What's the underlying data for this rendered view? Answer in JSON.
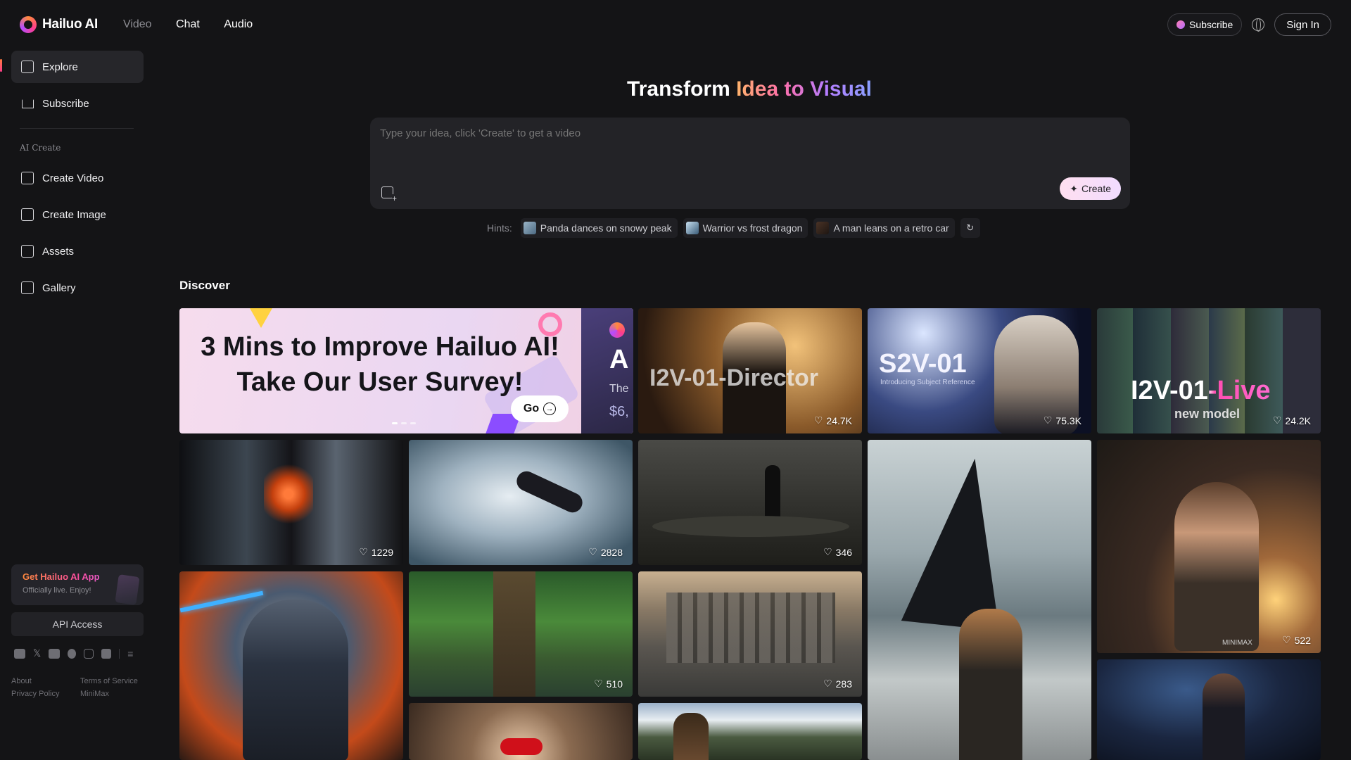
{
  "topbar": {
    "logo_text": "Hailuo AI",
    "nav": [
      "Video",
      "Chat",
      "Audio"
    ],
    "subscribe_label": "Subscribe",
    "signin_label": "Sign In"
  },
  "sidebar": {
    "explore": "Explore",
    "subscribe": "Subscribe",
    "section_heading": "AI Create",
    "create_video": "Create Video",
    "create_image": "Create Image",
    "assets": "Assets",
    "gallery": "Gallery",
    "app_card_title": "Get Hailuo AI App",
    "app_card_subtitle": "Officially live. Enjoy!",
    "api_access": "API Access",
    "footer": [
      "About",
      "Terms of Service",
      "Privacy Policy",
      "MiniMax"
    ]
  },
  "hero": {
    "title_plain": "Transform ",
    "title_grad": "Idea to Visual",
    "placeholder": "Type your idea, click 'Create' to get a video",
    "create_label": "Create",
    "hints_label": "Hints:",
    "hints": [
      "Panda dances on snowy peak",
      "Warrior vs frost dragon",
      "A man leans on a retro car"
    ]
  },
  "discover": {
    "heading": "Discover",
    "banner": {
      "line1": "3 Mins to Improve Hailuo AI!",
      "line2": "Take Our User Survey!",
      "go_label": "Go",
      "side_big": "A",
      "side_small1": "The",
      "side_small2": "$6,"
    },
    "cards": [
      {
        "overlay": "I2V-01-Director",
        "likes": "24.7K"
      },
      {
        "overlay": "S2V-01",
        "overlay_sub": "Introducing Subject Reference",
        "likes": "75.3K"
      },
      {
        "overlay": "I2V-01-Live",
        "overlay_sub": "new model",
        "likes": "24.2K"
      },
      {
        "likes": "1229"
      },
      {
        "likes": "2828"
      },
      {
        "likes": "346"
      },
      {
        "likes": "522"
      },
      {
        "likes": "510"
      },
      {
        "likes": "283"
      }
    ],
    "watermark": "MINIMAX"
  }
}
